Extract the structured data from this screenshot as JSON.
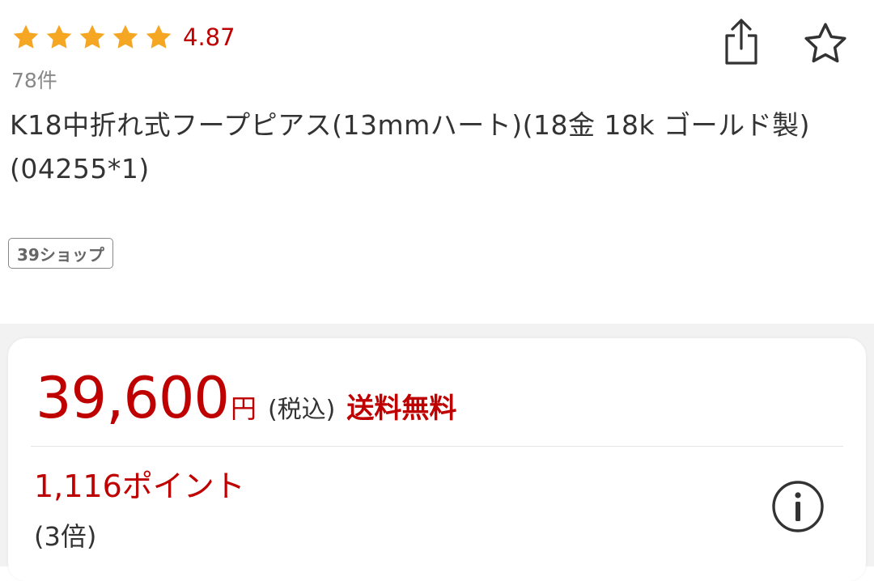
{
  "rating": {
    "stars": 5,
    "value": "4.87",
    "review_count": "78件",
    "star_color": "#f5a623"
  },
  "actions": {
    "share_icon": "share-icon",
    "favorite_icon": "star-outline-icon"
  },
  "product": {
    "title": "K18中折れ式フープピアス(13mmハート)(18金 18k ゴールド製)(04255*1)",
    "shop_badge": "39ショップ"
  },
  "price": {
    "value": "39,600",
    "unit": "円",
    "tax_label": "(税込)",
    "shipping_label": "送料無料",
    "points": "1,116ポイント",
    "multiplier": "(3倍)",
    "info_icon": "info-icon",
    "accent_color": "#bf0000"
  }
}
